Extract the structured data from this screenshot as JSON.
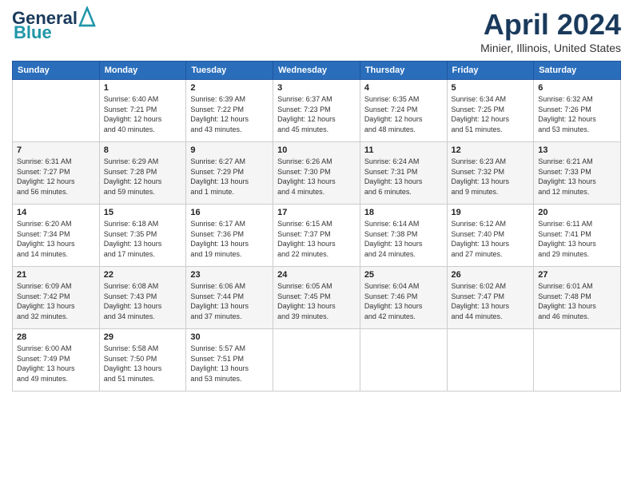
{
  "header": {
    "logo_general": "General",
    "logo_blue": "Blue",
    "month_title": "April 2024",
    "location": "Minier, Illinois, United States"
  },
  "weekdays": [
    "Sunday",
    "Monday",
    "Tuesday",
    "Wednesday",
    "Thursday",
    "Friday",
    "Saturday"
  ],
  "weeks": [
    [
      {
        "num": "",
        "info": ""
      },
      {
        "num": "1",
        "info": "Sunrise: 6:40 AM\nSunset: 7:21 PM\nDaylight: 12 hours\nand 40 minutes."
      },
      {
        "num": "2",
        "info": "Sunrise: 6:39 AM\nSunset: 7:22 PM\nDaylight: 12 hours\nand 43 minutes."
      },
      {
        "num": "3",
        "info": "Sunrise: 6:37 AM\nSunset: 7:23 PM\nDaylight: 12 hours\nand 45 minutes."
      },
      {
        "num": "4",
        "info": "Sunrise: 6:35 AM\nSunset: 7:24 PM\nDaylight: 12 hours\nand 48 minutes."
      },
      {
        "num": "5",
        "info": "Sunrise: 6:34 AM\nSunset: 7:25 PM\nDaylight: 12 hours\nand 51 minutes."
      },
      {
        "num": "6",
        "info": "Sunrise: 6:32 AM\nSunset: 7:26 PM\nDaylight: 12 hours\nand 53 minutes."
      }
    ],
    [
      {
        "num": "7",
        "info": "Sunrise: 6:31 AM\nSunset: 7:27 PM\nDaylight: 12 hours\nand 56 minutes."
      },
      {
        "num": "8",
        "info": "Sunrise: 6:29 AM\nSunset: 7:28 PM\nDaylight: 12 hours\nand 59 minutes."
      },
      {
        "num": "9",
        "info": "Sunrise: 6:27 AM\nSunset: 7:29 PM\nDaylight: 13 hours\nand 1 minute."
      },
      {
        "num": "10",
        "info": "Sunrise: 6:26 AM\nSunset: 7:30 PM\nDaylight: 13 hours\nand 4 minutes."
      },
      {
        "num": "11",
        "info": "Sunrise: 6:24 AM\nSunset: 7:31 PM\nDaylight: 13 hours\nand 6 minutes."
      },
      {
        "num": "12",
        "info": "Sunrise: 6:23 AM\nSunset: 7:32 PM\nDaylight: 13 hours\nand 9 minutes."
      },
      {
        "num": "13",
        "info": "Sunrise: 6:21 AM\nSunset: 7:33 PM\nDaylight: 13 hours\nand 12 minutes."
      }
    ],
    [
      {
        "num": "14",
        "info": "Sunrise: 6:20 AM\nSunset: 7:34 PM\nDaylight: 13 hours\nand 14 minutes."
      },
      {
        "num": "15",
        "info": "Sunrise: 6:18 AM\nSunset: 7:35 PM\nDaylight: 13 hours\nand 17 minutes."
      },
      {
        "num": "16",
        "info": "Sunrise: 6:17 AM\nSunset: 7:36 PM\nDaylight: 13 hours\nand 19 minutes."
      },
      {
        "num": "17",
        "info": "Sunrise: 6:15 AM\nSunset: 7:37 PM\nDaylight: 13 hours\nand 22 minutes."
      },
      {
        "num": "18",
        "info": "Sunrise: 6:14 AM\nSunset: 7:38 PM\nDaylight: 13 hours\nand 24 minutes."
      },
      {
        "num": "19",
        "info": "Sunrise: 6:12 AM\nSunset: 7:40 PM\nDaylight: 13 hours\nand 27 minutes."
      },
      {
        "num": "20",
        "info": "Sunrise: 6:11 AM\nSunset: 7:41 PM\nDaylight: 13 hours\nand 29 minutes."
      }
    ],
    [
      {
        "num": "21",
        "info": "Sunrise: 6:09 AM\nSunset: 7:42 PM\nDaylight: 13 hours\nand 32 minutes."
      },
      {
        "num": "22",
        "info": "Sunrise: 6:08 AM\nSunset: 7:43 PM\nDaylight: 13 hours\nand 34 minutes."
      },
      {
        "num": "23",
        "info": "Sunrise: 6:06 AM\nSunset: 7:44 PM\nDaylight: 13 hours\nand 37 minutes."
      },
      {
        "num": "24",
        "info": "Sunrise: 6:05 AM\nSunset: 7:45 PM\nDaylight: 13 hours\nand 39 minutes."
      },
      {
        "num": "25",
        "info": "Sunrise: 6:04 AM\nSunset: 7:46 PM\nDaylight: 13 hours\nand 42 minutes."
      },
      {
        "num": "26",
        "info": "Sunrise: 6:02 AM\nSunset: 7:47 PM\nDaylight: 13 hours\nand 44 minutes."
      },
      {
        "num": "27",
        "info": "Sunrise: 6:01 AM\nSunset: 7:48 PM\nDaylight: 13 hours\nand 46 minutes."
      }
    ],
    [
      {
        "num": "28",
        "info": "Sunrise: 6:00 AM\nSunset: 7:49 PM\nDaylight: 13 hours\nand 49 minutes."
      },
      {
        "num": "29",
        "info": "Sunrise: 5:58 AM\nSunset: 7:50 PM\nDaylight: 13 hours\nand 51 minutes."
      },
      {
        "num": "30",
        "info": "Sunrise: 5:57 AM\nSunset: 7:51 PM\nDaylight: 13 hours\nand 53 minutes."
      },
      {
        "num": "",
        "info": ""
      },
      {
        "num": "",
        "info": ""
      },
      {
        "num": "",
        "info": ""
      },
      {
        "num": "",
        "info": ""
      }
    ]
  ]
}
